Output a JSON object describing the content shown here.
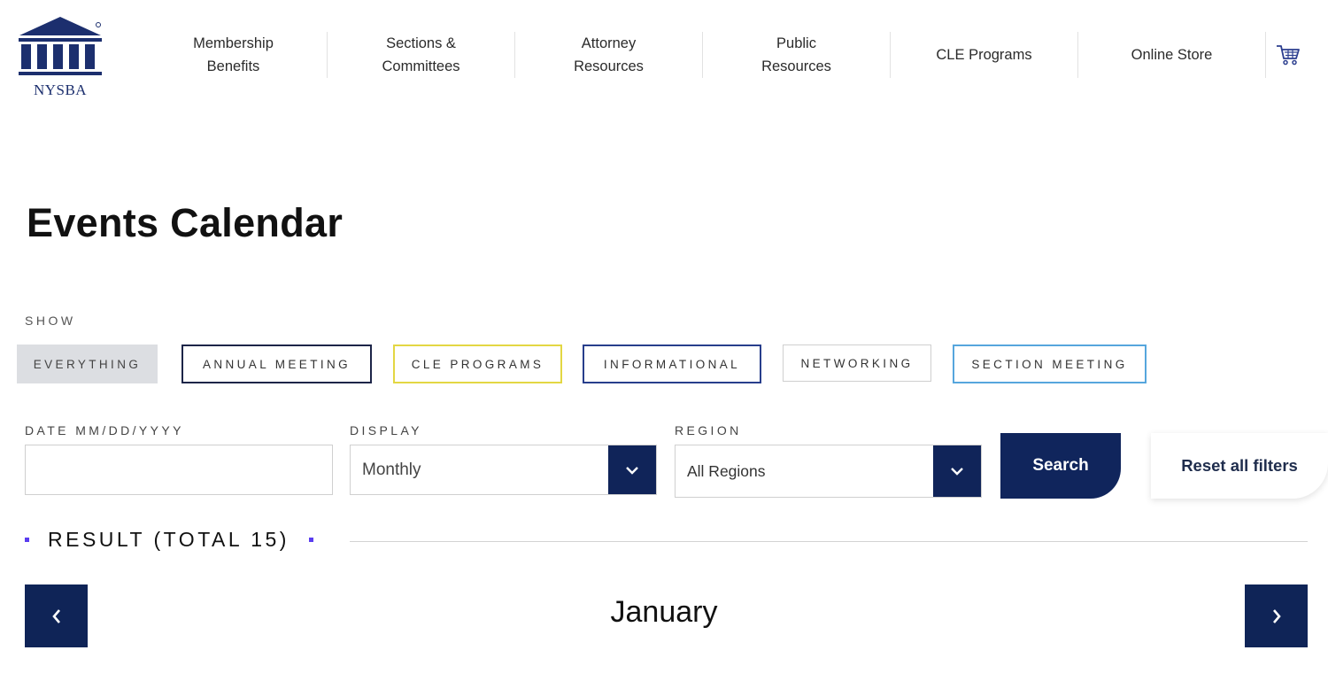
{
  "header": {
    "logo_text": "NYSBA",
    "nav": [
      {
        "label": "Membership\nBenefits"
      },
      {
        "label": "Sections &\nCommittees"
      },
      {
        "label": "Attorney\nResources"
      },
      {
        "label": "Public\nResources"
      },
      {
        "label": "CLE Programs"
      },
      {
        "label": "Online Store"
      }
    ],
    "cart_icon": "shopping-cart-icon"
  },
  "page": {
    "title": "Events Calendar"
  },
  "filters": {
    "show_label": "SHOW",
    "chips": [
      {
        "label": "EVERYTHING",
        "selected": true,
        "color": "#dcdee2"
      },
      {
        "label": "ANNUAL MEETING",
        "color": "#1d2548"
      },
      {
        "label": "CLE PROGRAMS",
        "color": "#e3d743"
      },
      {
        "label": "INFORMATIONAL",
        "color": "#283e8c"
      },
      {
        "label": "NETWORKING",
        "color": "#cfcfcf"
      },
      {
        "label": "SECTION MEETING",
        "color": "#56a6dd"
      }
    ],
    "date_label": "DATE MM/DD/YYYY",
    "date_value": "",
    "display_label": "DISPLAY",
    "display_value": "Monthly",
    "region_label": "REGION",
    "region_value": "All Regions",
    "search_label": "Search",
    "reset_label": "Reset all filters"
  },
  "results": {
    "text": "RESULT (TOTAL 15)"
  },
  "calendar": {
    "month": "January",
    "prev_icon": "chevron-left-icon",
    "next_icon": "chevron-right-icon"
  },
  "colors": {
    "brand_navy": "#0f2457",
    "accent_purple": "#5a3df0"
  }
}
